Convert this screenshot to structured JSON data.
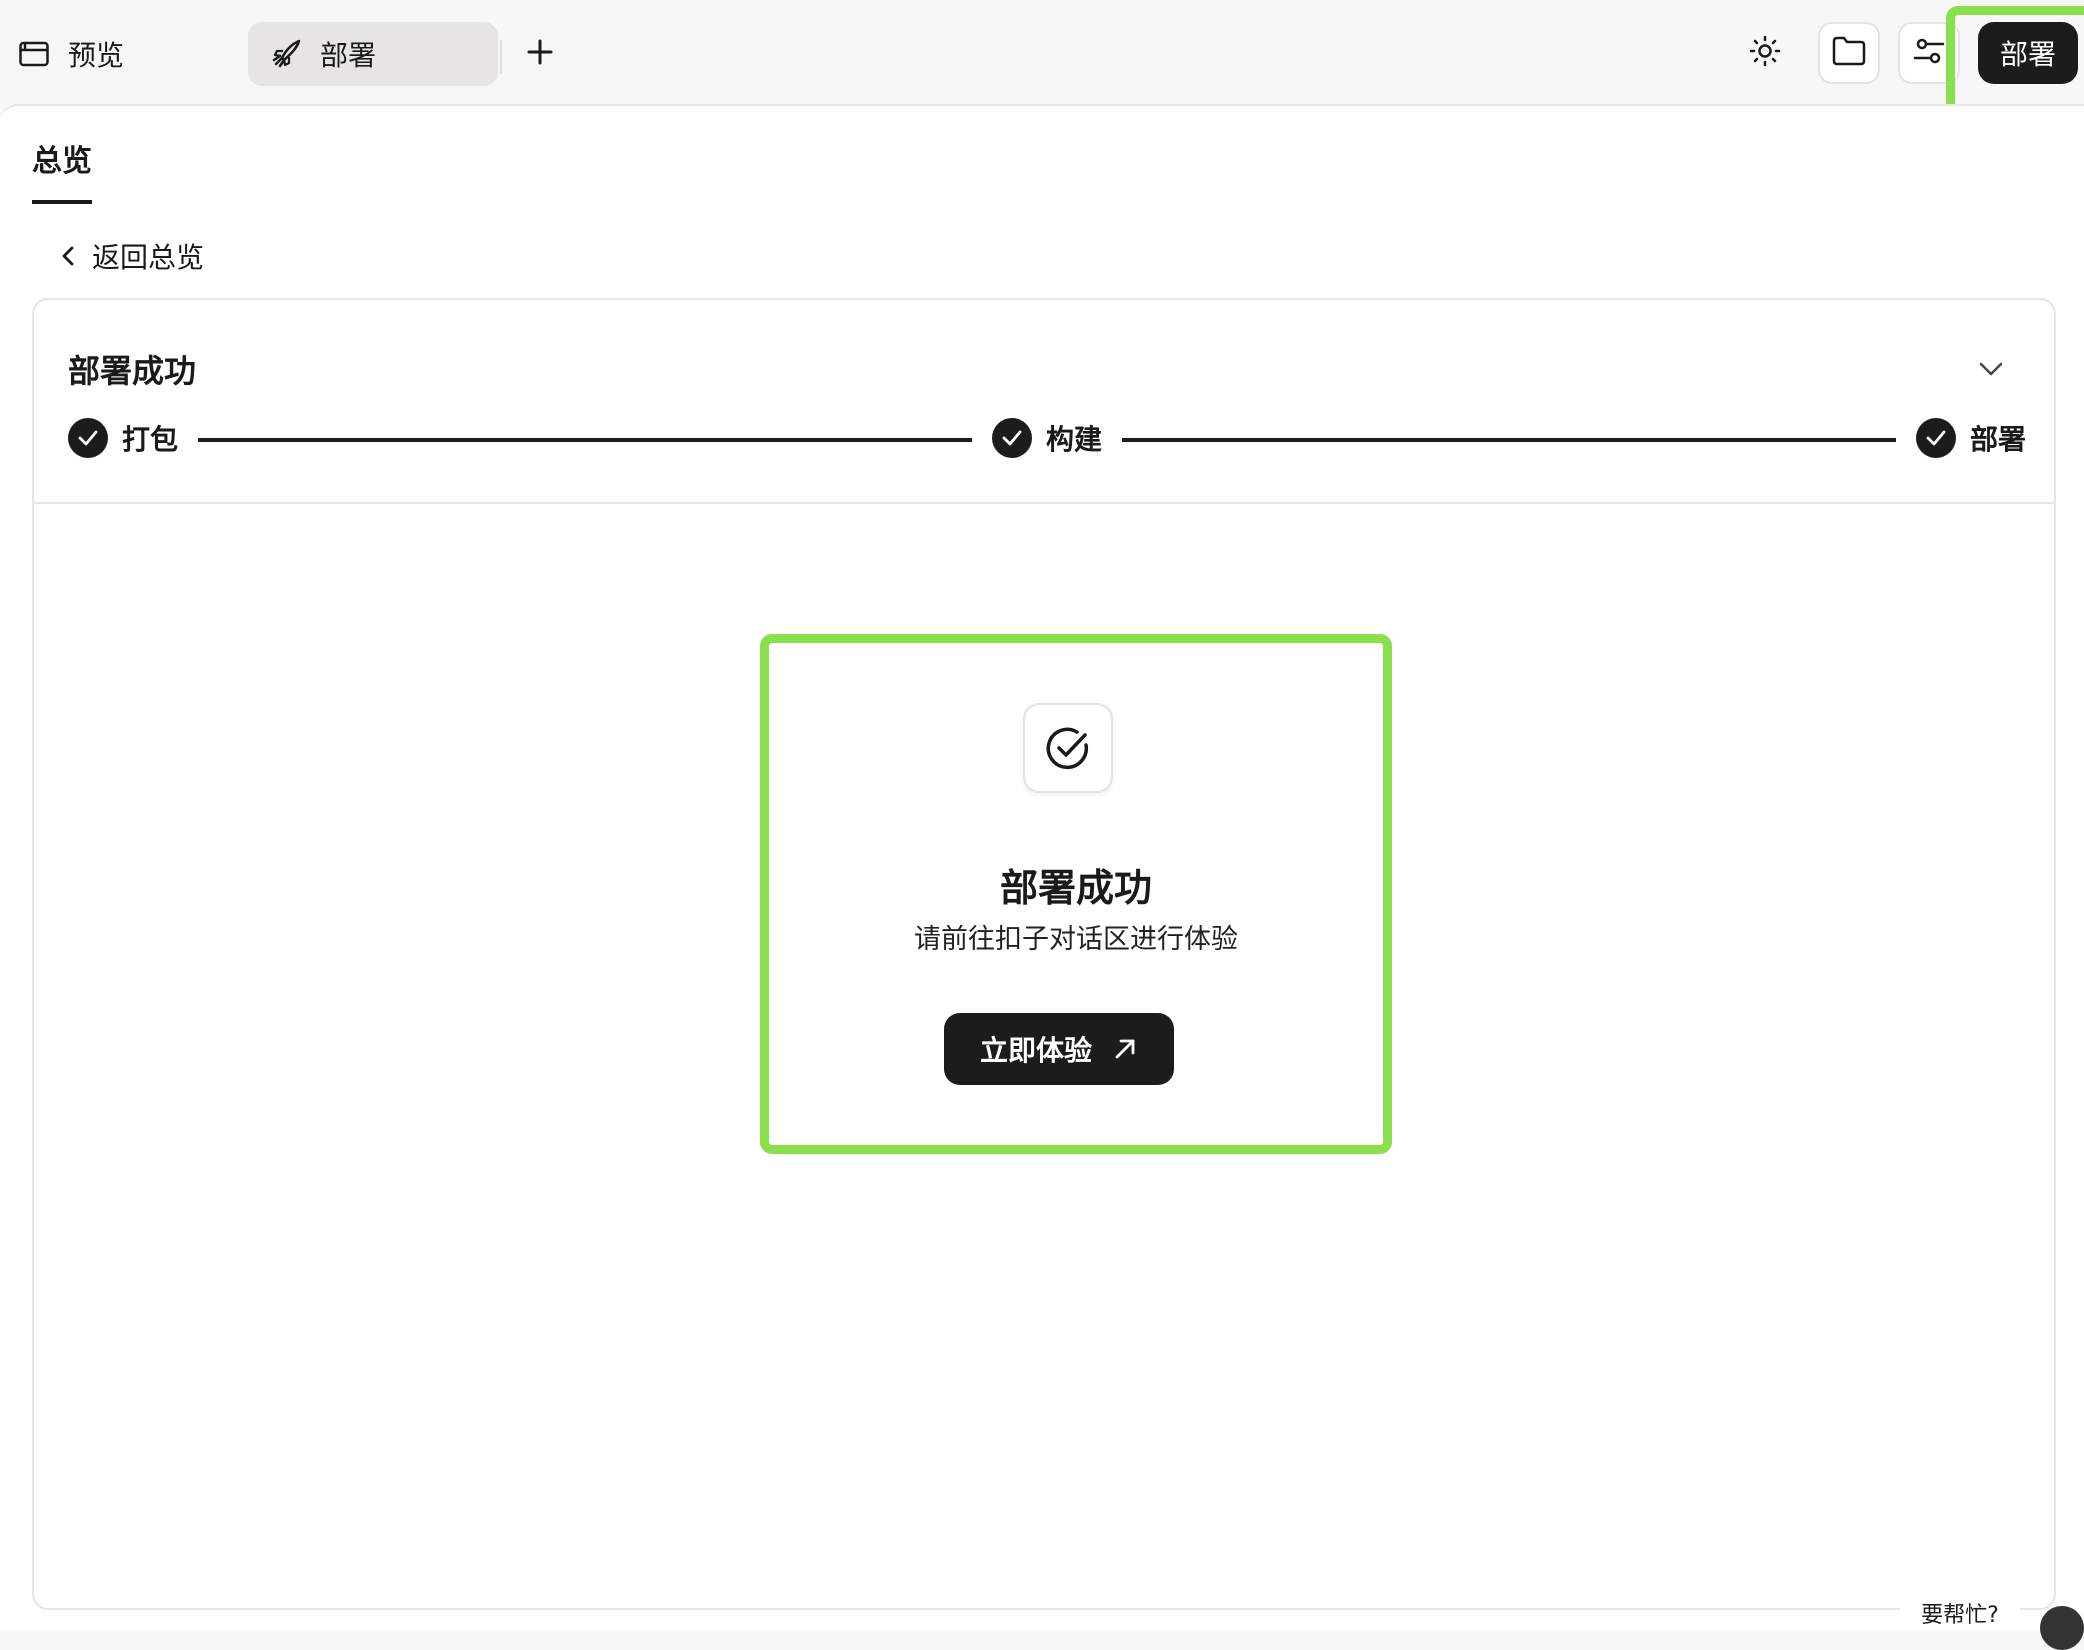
{
  "topbar": {
    "tabs": [
      {
        "label": "预览",
        "icon": "browser-window-icon"
      },
      {
        "label": "部署",
        "icon": "rocket-icon",
        "active": true
      }
    ],
    "add_tab_icon": "plus-icon",
    "theme_icon": "sun-icon",
    "folder_icon": "folder-icon",
    "settings_icon": "sliders-icon",
    "deploy_button": "部署"
  },
  "main": {
    "tab": "总览",
    "back_link": "返回总览",
    "status": {
      "title": "部署成功",
      "steps": [
        {
          "label": "打包",
          "done": true
        },
        {
          "label": "构建",
          "done": true
        },
        {
          "label": "部署",
          "done": true
        }
      ]
    },
    "result": {
      "title": "部署成功",
      "subtitle": "请前往扣子对话区进行体验",
      "button": "立即体验"
    }
  },
  "help": {
    "label": "要帮忙?"
  },
  "colors": {
    "accent_dark": "#1c1c1c",
    "highlight": "#8ae04c",
    "background": "#f7f7f7"
  }
}
